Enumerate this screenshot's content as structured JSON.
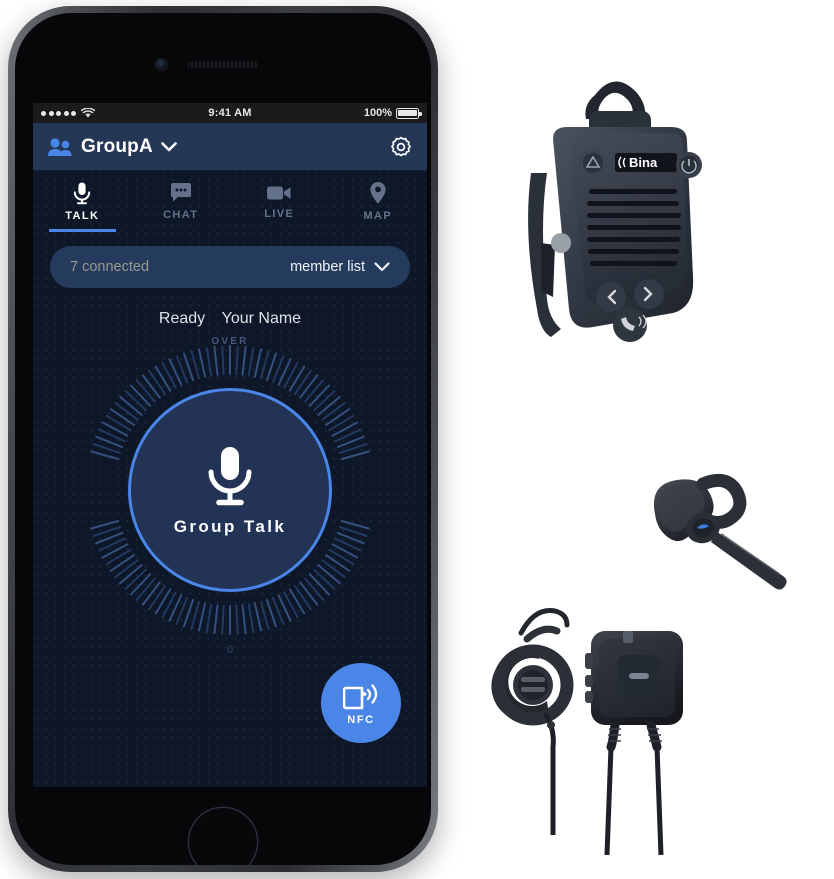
{
  "status_bar": {
    "signal_dots": 5,
    "wifi_icon": "wifi-icon",
    "time": "9:41 AM",
    "battery_percent": "100%"
  },
  "app_header": {
    "group_icon": "group-people-icon",
    "group_name": "GroupA",
    "chevron_icon": "chevron-down-icon",
    "settings_icon": "gear-icon"
  },
  "tabs": [
    {
      "label": "TALK",
      "icon": "microphone-icon",
      "active": true
    },
    {
      "label": "CHAT",
      "icon": "chat-bubble-icon",
      "active": false
    },
    {
      "label": "LIVE",
      "icon": "video-camera-icon",
      "active": false
    },
    {
      "label": "MAP",
      "icon": "map-pin-icon",
      "active": false
    }
  ],
  "member_bar": {
    "connected_text": "7 connected",
    "member_list_label": "member list",
    "chevron_icon": "chevron-down-icon"
  },
  "status_line": {
    "state": "Ready",
    "user_name": "Your Name"
  },
  "dial": {
    "top_label": "OVER",
    "bottom_label": "0"
  },
  "talk_button": {
    "label": "Group Talk",
    "icon": "microphone-icon"
  },
  "nfc_button": {
    "label": "NFC",
    "icon": "nfc-card-wave-icon"
  },
  "products": [
    {
      "name": "speaker-microphone",
      "brand_text": "Bina"
    },
    {
      "name": "bluetooth-ear-hook-headset"
    },
    {
      "name": "earpiece-with-ptt-module"
    }
  ],
  "colors": {
    "accent_blue": "#4a86e8",
    "header_navy": "#243755",
    "screen_bg": "#0d1728",
    "pill_navy": "#243b5e",
    "muted_text": "#9b9a8d"
  }
}
